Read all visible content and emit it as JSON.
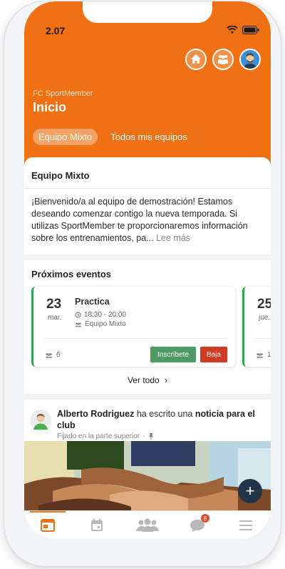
{
  "status_bar": {
    "time": "2.07"
  },
  "header": {
    "org_name": "FC SportMember",
    "title": "Inicio",
    "tabs": [
      {
        "label": "Equipo Mixto",
        "active": true
      },
      {
        "label": "Todos mis equipos",
        "active": false
      }
    ],
    "icons": [
      "home-icon",
      "team-icon",
      "user-avatar"
    ]
  },
  "team": {
    "name": "Equipo Mixto",
    "welcome": "¡Bienvenido/a al equipo de demostración! Estamos deseando comenzar contigo la nueva temporada. Si utilizas SportMember te proporcionaremos información sobre los entrenamientos, pa...",
    "read_more": "Lee más"
  },
  "events": {
    "title": "Próximos eventos",
    "items": [
      {
        "day": "23",
        "dow": "mar.",
        "name": "Practica",
        "time": "18:30 - 20:00",
        "team": "Equipo Mixto",
        "attendees": "6",
        "join_label": "Inscríbete",
        "leave_label": "Baja"
      },
      {
        "day": "25",
        "dow": "jue.",
        "attendees": "1"
      }
    ],
    "view_all": "Ver todo"
  },
  "post": {
    "author": "Alberto Rodriguez",
    "action": "ha escrito una",
    "object": "noticia para el club",
    "pinned": "Fijado en la parte superior"
  },
  "nav": {
    "items": [
      "news-icon",
      "calendar-icon",
      "members-icon",
      "chat-icon",
      "menu-icon"
    ],
    "chat_badge": "8"
  },
  "colors": {
    "brand": "#f07014",
    "green": "#4d9a63",
    "red": "#d03a22",
    "fab": "#203548"
  }
}
